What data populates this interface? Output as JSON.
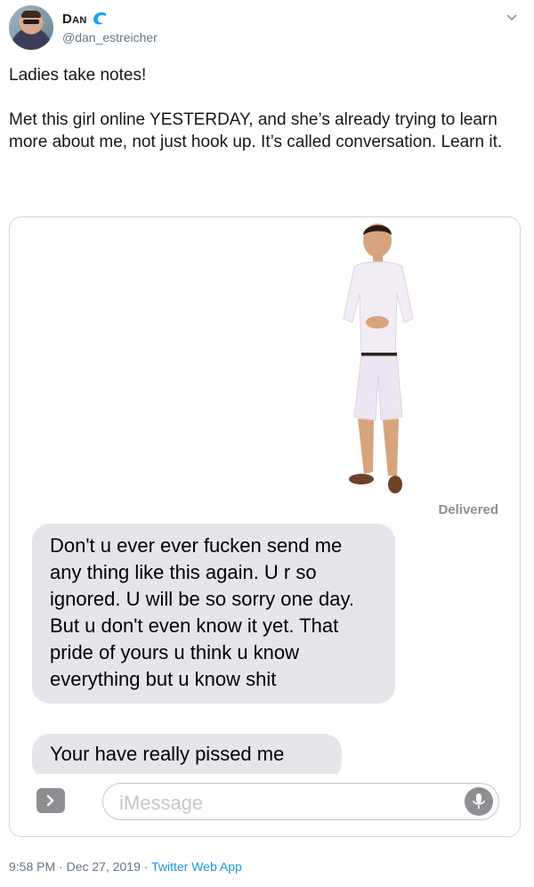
{
  "user": {
    "display_name": "Dan",
    "handle": "@dan_estreicher"
  },
  "tweet": {
    "text": "Ladies take notes!\n\nMet this girl online YESTERDAY, and she’s already trying to learn more about me, not just hook up. It’s called conversation. Learn it."
  },
  "conversation": {
    "status": "Delivered",
    "messages": [
      "Don't u ever ever fucken send me any thing like this again. U r so ignored. U will be so sorry one day. But u don't even know it yet. That pride of yours u think u know everything but u know shit",
      "Your have really pissed me"
    ],
    "input_placeholder": "iMessage"
  },
  "meta": {
    "time": "9:58 PM",
    "separator": " · ",
    "date": "Dec 27, 2019",
    "source": "Twitter Web App"
  },
  "colors": {
    "bubble_gray": "#e5e5ea",
    "link_blue": "#1b95e0",
    "secondary_text": "#657786",
    "wave_icon": "#1da1f2"
  },
  "icons": [
    "wave-icon",
    "chevron-down-icon",
    "chevron-right-icon",
    "microphone-icon"
  ]
}
